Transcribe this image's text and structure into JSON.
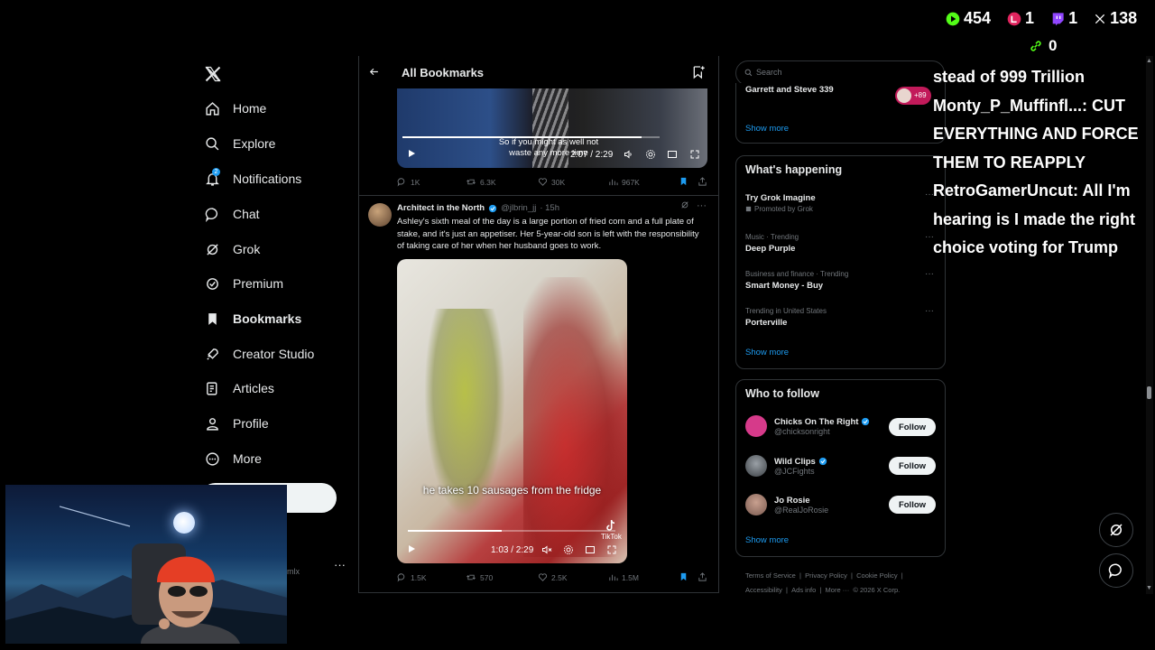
{
  "nav": {
    "items": [
      {
        "label": "Home",
        "icon": "home-icon"
      },
      {
        "label": "Explore",
        "icon": "search-icon"
      },
      {
        "label": "Notifications",
        "icon": "bell-icon",
        "badge": "2"
      },
      {
        "label": "Chat",
        "icon": "chat-bubble-icon"
      },
      {
        "label": "Grok",
        "icon": "grok-icon"
      },
      {
        "label": "Premium",
        "icon": "premium-check-icon"
      },
      {
        "label": "Bookmarks",
        "icon": "bookmark-icon",
        "active": true
      },
      {
        "label": "Creator Studio",
        "icon": "rocket-icon"
      },
      {
        "label": "Articles",
        "icon": "article-icon"
      },
      {
        "label": "Profile",
        "icon": "person-icon"
      },
      {
        "label": "More",
        "icon": "more-circle-icon"
      }
    ],
    "account_handle_fragment": "mlx",
    "account_menu": "···"
  },
  "main": {
    "title": "All Bookmarks",
    "tweet1": {
      "video": {
        "subtitle": "So if you might as well not waste any more time",
        "time": "2:07 / 2:29",
        "progress": 0.93
      },
      "actions": {
        "replies": "1K",
        "reposts": "6.3K",
        "likes": "30K",
        "views": "967K"
      }
    },
    "tweet2": {
      "author": "Architect in the North",
      "handle": "@jlbrin_jj",
      "time": "· 15h",
      "text": "Ashley's sixth meal of the day is a large portion of fried corn and a full plate of stake, and it's just an appetiser. Her 5-year-old son is left with the responsibility of taking care of her when her husband goes to work.",
      "video": {
        "caption": "he takes 10 sausages from the fridge",
        "time": "1:03 / 2:29",
        "progress": 0.45,
        "watermark": "TikTok"
      },
      "actions": {
        "replies": "1.5K",
        "reposts": "570",
        "likes": "2.5K",
        "views": "1.5M"
      }
    }
  },
  "sidebar": {
    "search_placeholder": "Search",
    "top_box": {
      "name": "Garrett and Steve 339",
      "avatar_count": "+89",
      "show_more": "Show more"
    },
    "happening": {
      "title": "What's happening",
      "trends": [
        {
          "category": "",
          "name": "Try Grok Imagine",
          "promoted": "Promoted by Grok"
        },
        {
          "category": "Music · Trending",
          "name": "Deep Purple"
        },
        {
          "category": "Business and finance · Trending",
          "name": "Smart Money - Buy"
        },
        {
          "category": "Trending in United States",
          "name": "Porterville"
        }
      ],
      "show_more": "Show more"
    },
    "who_to_follow": {
      "title": "Who to follow",
      "accounts": [
        {
          "name": "Chicks On The Right",
          "handle": "@chicksonright",
          "button": "Follow",
          "color": "#d63a8a"
        },
        {
          "name": "Wild Clips",
          "handle": "@JCFights",
          "button": "Follow",
          "color": "#3a3f44"
        },
        {
          "name": "Jo Rosie",
          "handle": "@RealJoRosie",
          "button": "Follow",
          "color": "#7a5a50"
        }
      ],
      "show_more": "Show more"
    },
    "footer": {
      "links": [
        "Terms of Service",
        "|",
        "Privacy Policy",
        "|",
        "Cookie Policy",
        "|",
        "Accessibility",
        "|",
        "Ads info",
        "|",
        "More ···",
        "© 2026 X Corp."
      ]
    }
  },
  "overlay": {
    "stats": [
      {
        "icon": "play-icon",
        "value": "454",
        "color": "#53fc18"
      },
      {
        "icon": "live-icon",
        "value": "1",
        "color": "#e0245e"
      },
      {
        "icon": "twitch-icon",
        "value": "1",
        "color": "#9146ff"
      },
      {
        "icon": "x-icon",
        "value": "138",
        "color": "#ffffff"
      }
    ],
    "link_stat": {
      "icon": "link-icon",
      "value": "0",
      "color": "#53fc18"
    },
    "chat_lines": [
      "stead of 999 Trillion",
      "Monty_P_Muffinfl...: CUT EVERYTHING AND FORCE THEM TO REAPPLY",
      "RetroGamerUncut: All I'm hearing is I made the right choice voting for Trump"
    ]
  },
  "colors": {
    "accent": "#1d9bf0",
    "verified": "#1d9bf0",
    "background": "#000000",
    "border": "#2f3336"
  }
}
